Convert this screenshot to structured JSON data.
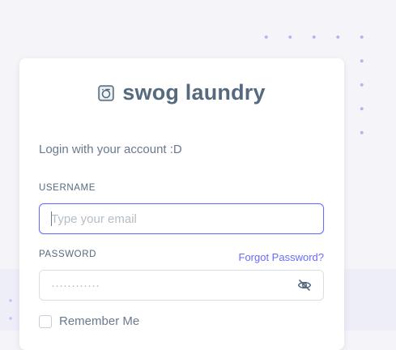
{
  "brand": {
    "name": "swog laundry",
    "icon": "washing-machine-icon"
  },
  "login": {
    "welcome": "Login with your account :D",
    "username": {
      "label": "USERNAME",
      "placeholder": "Type your email",
      "value": ""
    },
    "password": {
      "label": "PASSWORD",
      "placeholder": "············",
      "value": "",
      "toggle_icon": "eye-off-icon"
    },
    "forgot_password": "Forgot Password?",
    "remember_me": {
      "label": "Remember Me",
      "checked": false
    }
  },
  "colors": {
    "accent": "#696cff",
    "heading": "#566a7f",
    "text": "#697a8d",
    "background": "#f5f5f9"
  }
}
